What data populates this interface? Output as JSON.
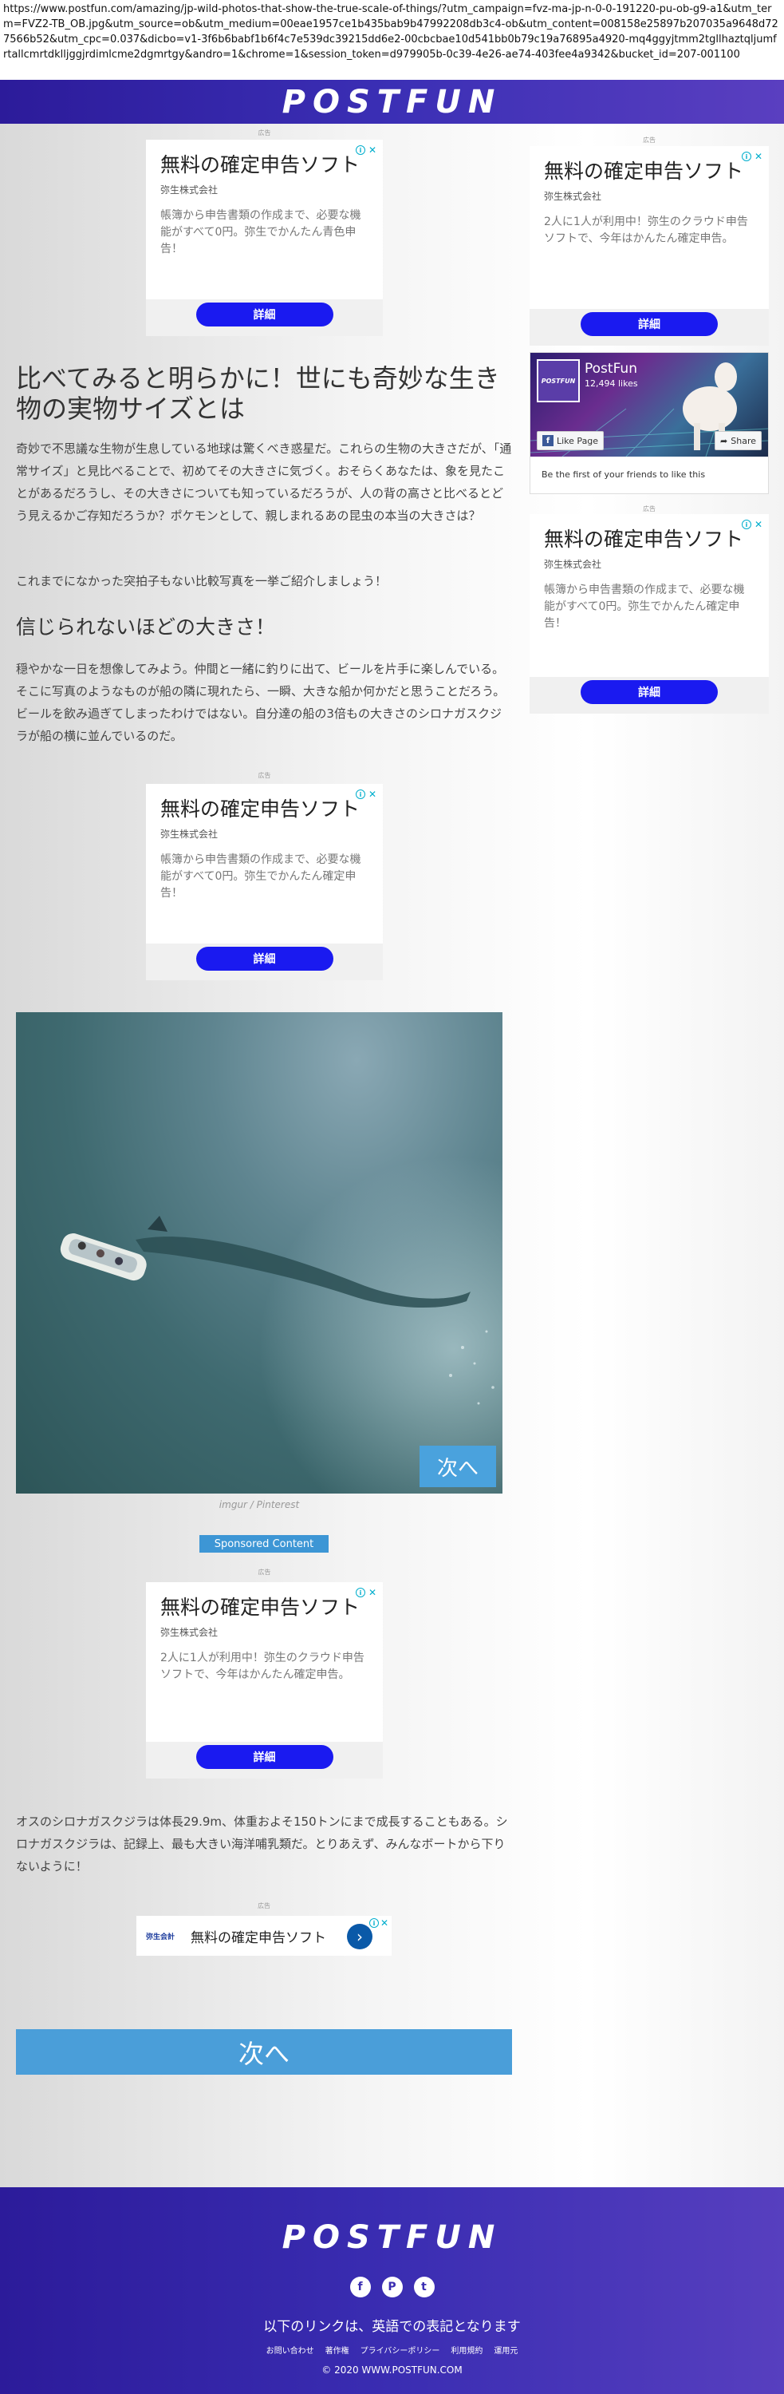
{
  "url": "https://www.postfun.com/amazing/jp-wild-photos-that-show-the-true-scale-of-things/?utm_campaign=fvz-ma-jp-n-0-0-191220-pu-ob-g9-a1&utm_term=FVZ2-TB_OB.jpg&utm_source=ob&utm_medium=00eae1957ce1b435bab9b47992208db3c4-ob&utm_content=008158e25897b207035a9648d727566b52&utm_cpc=0.037&dicbo=v1-3f6b6babf1b6f4c7e539dc39215dd6e2-00cbcbae10d541bb0b79c19a76895a4920-mq4ggyjtmm2tgllhaztqljumfrtallcmrtdklljggjrdimlcme2dgmrtgy&andro=1&chrome=1&session_token=d979905b-0c39-4e26-ae74-403fee4a9342&bucket_id=207-001100",
  "header": {
    "logo": "POSTFUN"
  },
  "ads": {
    "label": "広告",
    "title": "無料の確定申告ソフト",
    "company": "弥生株式会社",
    "desc_a": "帳簿から申告書類の作成まで、必要な機能がすべて0円。弥生でかんたん青色申告！",
    "desc_b": "2人に1人が利用中！弥生のクラウド申告ソフトで、今年はかんたん確定申告。",
    "desc_c": "帳簿から申告書類の作成まで、必要な機能がすべて0円。弥生でかんたん確定申告！",
    "button": "詳細",
    "info": "i",
    "close": "✕"
  },
  "article": {
    "headline": "比べてみると明らかに！世にも奇妙な生き物の実物サイズとは",
    "p1": "奇妙で不思議な生物が生息している地球は驚くべき惑星だ。これらの生物の大きさだが、「通常サイズ」と見比べることで、初めてその大きさに気づく。おそらくあなたは、象を見たことがあるだろうし、その大きさについても知っているだろうが、人の背の高さと比べるとどう見えるかご存知だろうか？ポケモンとして、親しまれるあの昆虫の本当の大きさは？",
    "p2": "これまでになかった突拍子もない比較写真を一挙ご紹介しましょう！",
    "subhead": "信じられないほどの大きさ！",
    "p3": "穏やかな一日を想像してみよう。仲間と一緒に釣りに出て、ビールを片手に楽しんでいる。そこに写真のようなものが船の隣に現れたら、一瞬、大きな船か何かだと思うことだろう。ビールを飲み過ぎてしまったわけではない。自分達の船の3倍もの大きさのシロナガスクジラが船の横に並んでいるのだ。",
    "photo_next": "次へ",
    "caption": "imgur / Pinterest",
    "sponsored": "Sponsored Content",
    "p4": "オスのシロナガスクジラは体長29.9m、体重およそ150トンにまで成長することもある。シロナガスクジラは、記録上、最も大きい海洋哺乳類だ。とりあえず、みんなボートから下りないように！",
    "banner_logo": "弥生会計",
    "banner_title": "無料の確定申告ソフト",
    "banner_arrow": "›",
    "next_big": "次へ"
  },
  "facebook": {
    "thumb": "POSTFUN",
    "name": "PostFun",
    "likes": "12,494 likes",
    "like_page": "Like Page",
    "share": "Share",
    "friends": "Be the first of your friends to like this"
  },
  "footer": {
    "logo": "POSTFUN",
    "social": [
      "f",
      "P",
      "t"
    ],
    "note": "以下のリンクは、英語での表記となります",
    "links": [
      "お問い合わせ",
      "著作権",
      "プライバシーポリシー",
      "利用規約",
      "運用元"
    ],
    "copyright": "© 2020 WWW.POSTFUN.COM"
  }
}
